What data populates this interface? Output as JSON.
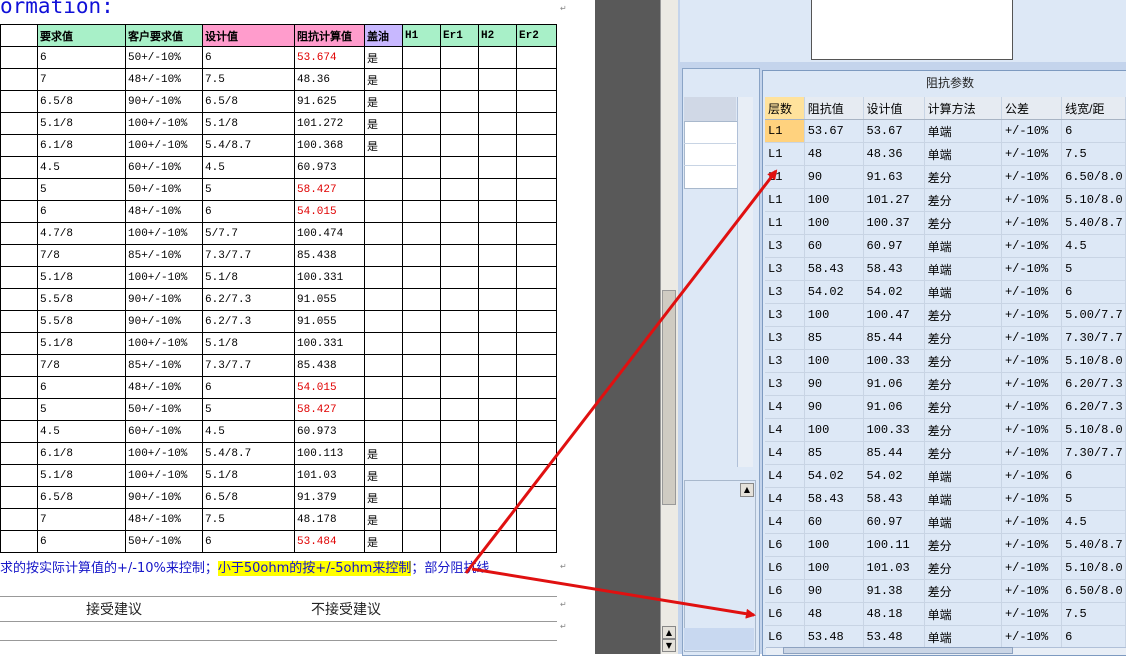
{
  "doc": {
    "title": "ormation:",
    "table": {
      "headers": [
        "要求值",
        "客户要求值",
        "设计值",
        "阻抗计算值",
        "盖油",
        "H1",
        "Er1",
        "H2",
        "Er2"
      ],
      "rows": [
        [
          "6",
          "50+/-10%",
          "6",
          "53.674",
          "是",
          "",
          "",
          "",
          ""
        ],
        [
          "7",
          "48+/-10%",
          "7.5",
          "48.36",
          "是",
          "",
          "",
          "",
          ""
        ],
        [
          "6.5/8",
          "90+/-10%",
          "6.5/8",
          "91.625",
          "是",
          "",
          "",
          "",
          ""
        ],
        [
          "5.1/8",
          "100+/-10%",
          "5.1/8",
          "101.272",
          "是",
          "",
          "",
          "",
          ""
        ],
        [
          "6.1/8",
          "100+/-10%",
          "5.4/8.7",
          "100.368",
          "是",
          "",
          "",
          "",
          ""
        ],
        [
          "4.5",
          "60+/-10%",
          "4.5",
          "60.973",
          "",
          "",
          "",
          "",
          ""
        ],
        [
          "5",
          "50+/-10%",
          "5",
          "58.427",
          "",
          "",
          "",
          "",
          ""
        ],
        [
          "6",
          "48+/-10%",
          "6",
          "54.015",
          "",
          "",
          "",
          "",
          ""
        ],
        [
          "4.7/8",
          "100+/-10%",
          "5/7.7",
          "100.474",
          "",
          "",
          "",
          "",
          ""
        ],
        [
          "7/8",
          "85+/-10%",
          "7.3/7.7",
          "85.438",
          "",
          "",
          "",
          "",
          ""
        ],
        [
          "5.1/8",
          "100+/-10%",
          "5.1/8",
          "100.331",
          "",
          "",
          "",
          "",
          ""
        ],
        [
          "5.5/8",
          "90+/-10%",
          "6.2/7.3",
          "91.055",
          "",
          "",
          "",
          "",
          ""
        ],
        [
          "5.5/8",
          "90+/-10%",
          "6.2/7.3",
          "91.055",
          "",
          "",
          "",
          "",
          ""
        ],
        [
          "5.1/8",
          "100+/-10%",
          "5.1/8",
          "100.331",
          "",
          "",
          "",
          "",
          ""
        ],
        [
          "7/8",
          "85+/-10%",
          "7.3/7.7",
          "85.438",
          "",
          "",
          "",
          "",
          ""
        ],
        [
          "6",
          "48+/-10%",
          "6",
          "54.015",
          "",
          "",
          "",
          "",
          ""
        ],
        [
          "5",
          "50+/-10%",
          "5",
          "58.427",
          "",
          "",
          "",
          "",
          ""
        ],
        [
          "4.5",
          "60+/-10%",
          "4.5",
          "60.973",
          "",
          "",
          "",
          "",
          ""
        ],
        [
          "6.1/8",
          "100+/-10%",
          "5.4/8.7",
          "100.113",
          "是",
          "",
          "",
          "",
          ""
        ],
        [
          "5.1/8",
          "100+/-10%",
          "5.1/8",
          "101.03",
          "是",
          "",
          "",
          "",
          ""
        ],
        [
          "6.5/8",
          "90+/-10%",
          "6.5/8",
          "91.379",
          "是",
          "",
          "",
          "",
          ""
        ],
        [
          "7",
          "48+/-10%",
          "7.5",
          "48.178",
          "是",
          "",
          "",
          "",
          ""
        ],
        [
          "6",
          "50+/-10%",
          "6",
          "53.484",
          "是",
          "",
          "",
          "",
          ""
        ]
      ],
      "red_values": [
        "53.674",
        "58.427",
        "54.015",
        "53.484"
      ],
      "header_colors": {
        "green": "#a8f0c8",
        "pink": "#ff9ccc",
        "violet": "#c8b8ff"
      },
      "red_color": "#e00000"
    },
    "note_before": "求的按实际计算值的+/-10%来控制；",
    "note_highlight": "小于50ohm的按+/-5ohm来控制",
    "note_after": "；部分阻抗线",
    "highlight_color": "#ffff00",
    "accept_label": "接受建议",
    "reject_label": "不接受建议"
  },
  "app": {
    "panel_title": "阻抗参数",
    "columns": [
      "层数",
      "阻抗值",
      "设计值",
      "计算方法",
      "公差",
      "线宽/距"
    ],
    "rows": [
      [
        "L1",
        "53.67",
        "53.67",
        "单端",
        "+/-10%",
        "6"
      ],
      [
        "L1",
        "48",
        "48.36",
        "单端",
        "+/-10%",
        "7.5"
      ],
      [
        "L1",
        "90",
        "91.63",
        "差分",
        "+/-10%",
        "6.50/8.0"
      ],
      [
        "L1",
        "100",
        "101.27",
        "差分",
        "+/-10%",
        "5.10/8.0"
      ],
      [
        "L1",
        "100",
        "100.37",
        "差分",
        "+/-10%",
        "5.40/8.7"
      ],
      [
        "L3",
        "60",
        "60.97",
        "单端",
        "+/-10%",
        "4.5"
      ],
      [
        "L3",
        "58.43",
        "58.43",
        "单端",
        "+/-10%",
        "5"
      ],
      [
        "L3",
        "54.02",
        "54.02",
        "单端",
        "+/-10%",
        "6"
      ],
      [
        "L3",
        "100",
        "100.47",
        "差分",
        "+/-10%",
        "5.00/7.7"
      ],
      [
        "L3",
        "85",
        "85.44",
        "差分",
        "+/-10%",
        "7.30/7.7"
      ],
      [
        "L3",
        "100",
        "100.33",
        "差分",
        "+/-10%",
        "5.10/8.0"
      ],
      [
        "L3",
        "90",
        "91.06",
        "差分",
        "+/-10%",
        "6.20/7.3"
      ],
      [
        "L4",
        "90",
        "91.06",
        "差分",
        "+/-10%",
        "6.20/7.3"
      ],
      [
        "L4",
        "100",
        "100.33",
        "差分",
        "+/-10%",
        "5.10/8.0"
      ],
      [
        "L4",
        "85",
        "85.44",
        "差分",
        "+/-10%",
        "7.30/7.7"
      ],
      [
        "L4",
        "54.02",
        "54.02",
        "单端",
        "+/-10%",
        "6"
      ],
      [
        "L4",
        "58.43",
        "58.43",
        "单端",
        "+/-10%",
        "5"
      ],
      [
        "L4",
        "60",
        "60.97",
        "单端",
        "+/-10%",
        "4.5"
      ],
      [
        "L6",
        "100",
        "100.11",
        "差分",
        "+/-10%",
        "5.40/8.7"
      ],
      [
        "L6",
        "100",
        "101.03",
        "差分",
        "+/-10%",
        "5.10/8.0"
      ],
      [
        "L6",
        "90",
        "91.38",
        "差分",
        "+/-10%",
        "6.50/8.0"
      ],
      [
        "L6",
        "48",
        "48.18",
        "单端",
        "+/-10%",
        "7.5"
      ],
      [
        "L6",
        "53.48",
        "53.48",
        "单端",
        "+/-10%",
        "6"
      ]
    ],
    "selected_row": 0,
    "row_marker_color": "#ffd27e"
  },
  "annotations": {
    "arrow_color": "#e01010",
    "arrows": [
      "note-to-row-L1-48",
      "note-to-row-L6-48"
    ]
  },
  "scroll": {
    "up_glyph": "▲",
    "down_glyph": "▼",
    "end_glyph": "▲"
  }
}
